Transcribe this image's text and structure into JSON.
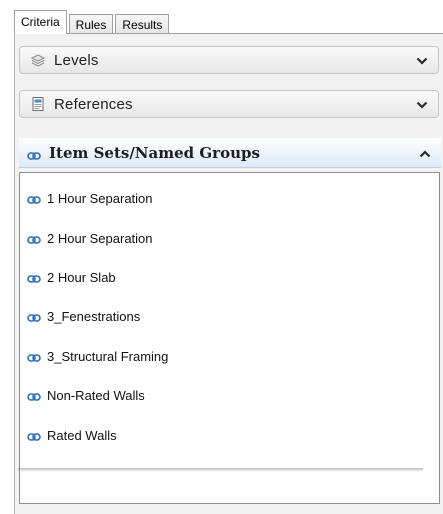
{
  "tabs": [
    {
      "label": "Criteria",
      "active": true
    },
    {
      "label": "Rules",
      "active": false
    },
    {
      "label": "Results",
      "active": false
    }
  ],
  "sections": [
    {
      "label": "Levels",
      "icon": "layers-icon",
      "expanded": false
    },
    {
      "label": "References",
      "icon": "document-icon",
      "expanded": false
    },
    {
      "label": "Item Sets/Named Groups",
      "icon": "chain-link-icon",
      "expanded": true
    }
  ],
  "item_sets": [
    {
      "label": "1 Hour Separation",
      "icon": "chain-link-icon"
    },
    {
      "label": "2 Hour Separation",
      "icon": "chain-link-icon"
    },
    {
      "label": "2 Hour Slab",
      "icon": "chain-link-icon"
    },
    {
      "label": "3_Fenestrations",
      "icon": "chain-link-icon"
    },
    {
      "label": "3_Structural Framing",
      "icon": "chain-link-icon"
    },
    {
      "label": "Non-Rated Walls",
      "icon": "chain-link-icon"
    },
    {
      "label": "Rated Walls",
      "icon": "chain-link-icon"
    }
  ],
  "colors": {
    "accent_header": "#dceaf7",
    "chain_icon": "#2f6fb5"
  }
}
